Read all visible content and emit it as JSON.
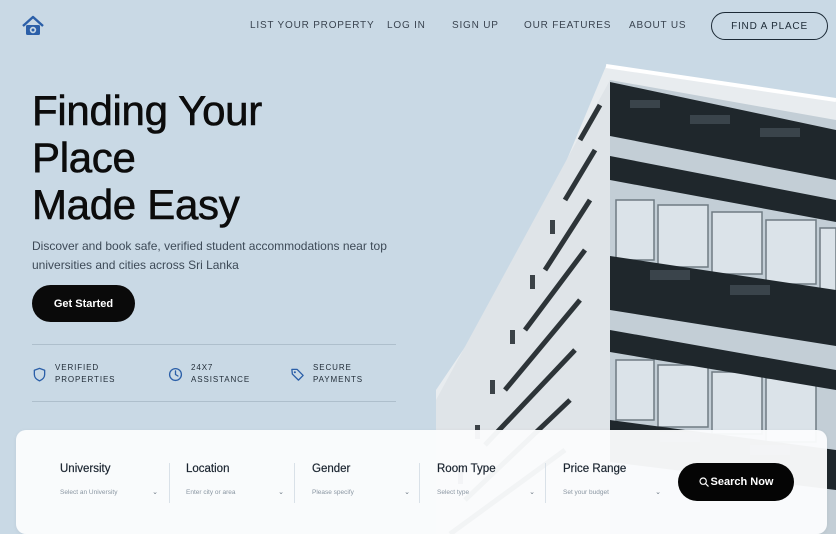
{
  "nav": {
    "links": [
      {
        "label": "LIST YOUR PROPERTY"
      },
      {
        "label": "LOG IN"
      },
      {
        "label": "SIGN UP"
      },
      {
        "label": "OUR FEATURES"
      },
      {
        "label": "ABOUT US"
      }
    ],
    "cta_label": "FIND A PLACE"
  },
  "hero": {
    "title_lines": [
      "Finding Your",
      "Place",
      "Made Easy"
    ],
    "subtitle": "Discover and book safe, verified student accommodations near top universities and cities across Sri Lanka",
    "cta_label": "Get Started"
  },
  "features": [
    {
      "line1": "VERIFIED",
      "line2": "PROPERTIES",
      "icon": "shield-icon"
    },
    {
      "line1": "24X7",
      "line2": "ASSISTANCE",
      "icon": "clock-icon"
    },
    {
      "line1": "SECURE",
      "line2": "PAYMENTS",
      "icon": "tag-icon"
    }
  ],
  "search": {
    "fields": [
      {
        "label": "University",
        "placeholder": "Select an University"
      },
      {
        "label": "Location",
        "placeholder": "Enter city or area"
      },
      {
        "label": "Gender",
        "placeholder": "Please specify"
      },
      {
        "label": "Room Type",
        "placeholder": "Select type"
      },
      {
        "label": "Price Range",
        "placeholder": "Set your budget"
      }
    ],
    "button_label": "Search Now"
  },
  "colors": {
    "background": "#c9d9e5",
    "accent": "#2b5fa8",
    "button": "#0a0a0a"
  }
}
